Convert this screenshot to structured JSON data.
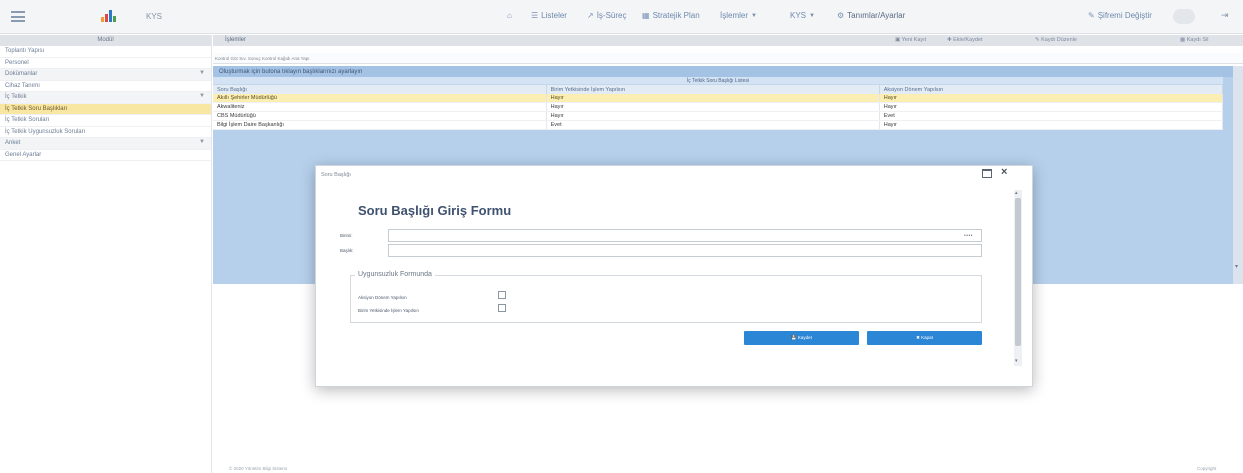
{
  "topbar": {
    "brand": "KYS",
    "nav": {
      "listeler": "Listeler",
      "is_surec": "İş-Süreç",
      "stratejik_plan": "Stratejik Plan",
      "islemler": "İşlemler",
      "kys": "KYS",
      "tanimlar": "Tanımlar/Ayarlar",
      "sifre": "Şifremi Değiştir"
    }
  },
  "sidebar": {
    "header": "Modül",
    "items": [
      {
        "label": "Toplantı Yapısı",
        "type": "item"
      },
      {
        "label": "Personel",
        "type": "item"
      },
      {
        "label": "Dokümanlar",
        "type": "cat"
      },
      {
        "label": "Cihaz Tanımı",
        "type": "item"
      },
      {
        "label": "İç Tetkik",
        "type": "cat"
      },
      {
        "label": "İç Tetkik Soru Başlıkları",
        "type": "active"
      },
      {
        "label": "İç Tetkik Soruları",
        "type": "item"
      },
      {
        "label": "İç Tetkik Uygunsuzluk Soruları",
        "type": "item"
      },
      {
        "label": "Anket",
        "type": "cat"
      },
      {
        "label": "Genel Ayarlar",
        "type": "item"
      }
    ]
  },
  "main": {
    "title": "İşlemler",
    "toolbar": {
      "yeni": "Yeni Kayıt",
      "ekle": "Ekle/Kaydet",
      "duzenle": "Kaydı Düzenle",
      "sil": "Kaydı Sil"
    },
    "breadcrumb": "Kontrol Gör Sıv. Sonuç Kontrol Kağıdı Ana Yapı",
    "grid": {
      "header": "Oluşturmak için butona tıklayın başlıklarınızı ayarlayın",
      "subheader": "İç Tetkik Soru Başlığı Listesi",
      "columns": [
        "Soru Başlığı",
        "Birim Yetkisinde İşlem Yapılsın",
        "Aksiyon Dönem Yapılsın"
      ],
      "rows": [
        [
          "Akıllı Şehirler Müdürlüğü",
          "Hayır",
          "Hayır"
        ],
        [
          "Akwaliteniz",
          "Hayır",
          "Hayır"
        ],
        [
          "CBS Müdürlüğü",
          "Hayır",
          "Evet"
        ],
        [
          "Bilgi İşlem Daire Başkanlığı",
          "Evet",
          "Hayır"
        ]
      ]
    },
    "footer_left": "© 2020 Yönetim Bilgi Sistemi",
    "footer_right": "Copyright"
  },
  "modal": {
    "window_title": "Soru Başlığı",
    "form_title": "Soru Başlığı Giriş Formu",
    "label_birim": "Birimi:",
    "label_baslik": "Başlık:",
    "dots": "••••",
    "fieldset_legend": "Uygunsuzluk Formunda",
    "check1_label": "Aksiyon Dönem Yapılsın",
    "check2_label": "Birim Yetkisinde İşlem Yapılsın",
    "save_label": "Kaydet",
    "cancel_label": "Kapat"
  },
  "colors": {
    "accent": "#2c86d6",
    "selection": "#f8e6a3",
    "grid_bg": "#b6d0ec"
  }
}
